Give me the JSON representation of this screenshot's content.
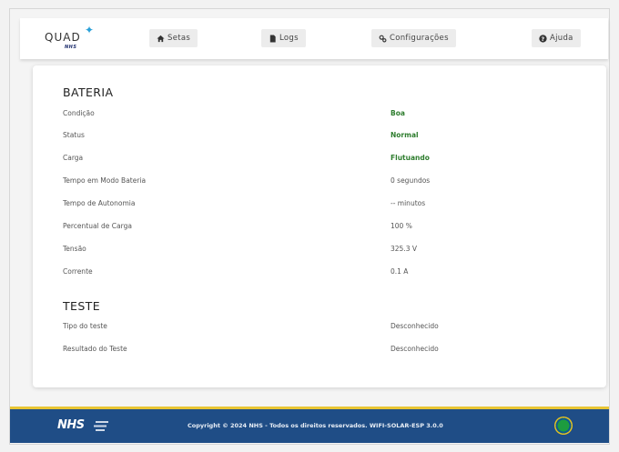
{
  "nav": {
    "logo_text": "QUAD",
    "logo_sub": "NHS",
    "items": [
      {
        "label": "Setas",
        "icon": "home-icon"
      },
      {
        "label": "Logs",
        "icon": "file-icon"
      },
      {
        "label": "Configurações",
        "icon": "gears-icon"
      },
      {
        "label": "Ajuda",
        "icon": "help-circle-icon"
      }
    ]
  },
  "bateria": {
    "title": "BATERIA",
    "rows": [
      {
        "label": "Condição",
        "value": "Boa",
        "status": "green"
      },
      {
        "label": "Status",
        "value": "Normal",
        "status": "green"
      },
      {
        "label": "Carga",
        "value": "Flutuando",
        "status": "green"
      },
      {
        "label": "Tempo em Modo Bateria",
        "value": "0 segundos",
        "status": "plain"
      },
      {
        "label": "Tempo de Autonomia",
        "value": "-- minutos",
        "status": "plain"
      },
      {
        "label": "Percentual de Carga",
        "value": "100 %",
        "status": "plain"
      },
      {
        "label": "Tensão",
        "value": "325.3 V",
        "status": "plain"
      },
      {
        "label": "Corrente",
        "value": "0.1 A",
        "status": "plain"
      }
    ]
  },
  "teste": {
    "title": "TESTE",
    "rows": [
      {
        "label": "Tipo do teste",
        "value": "Desconhecido"
      },
      {
        "label": "Resultado do Teste",
        "value": "Desconhecido"
      }
    ]
  },
  "footer": {
    "logo": "NHS",
    "copyright": "Copyright © 2024 NHS - Todos os direitos reservados. WIFI-SOLAR-ESP 3.0.0"
  },
  "colors": {
    "green_value": "#2e7d2e",
    "footer_bg": "#1f4d86",
    "footer_accent": "#e8c534"
  }
}
